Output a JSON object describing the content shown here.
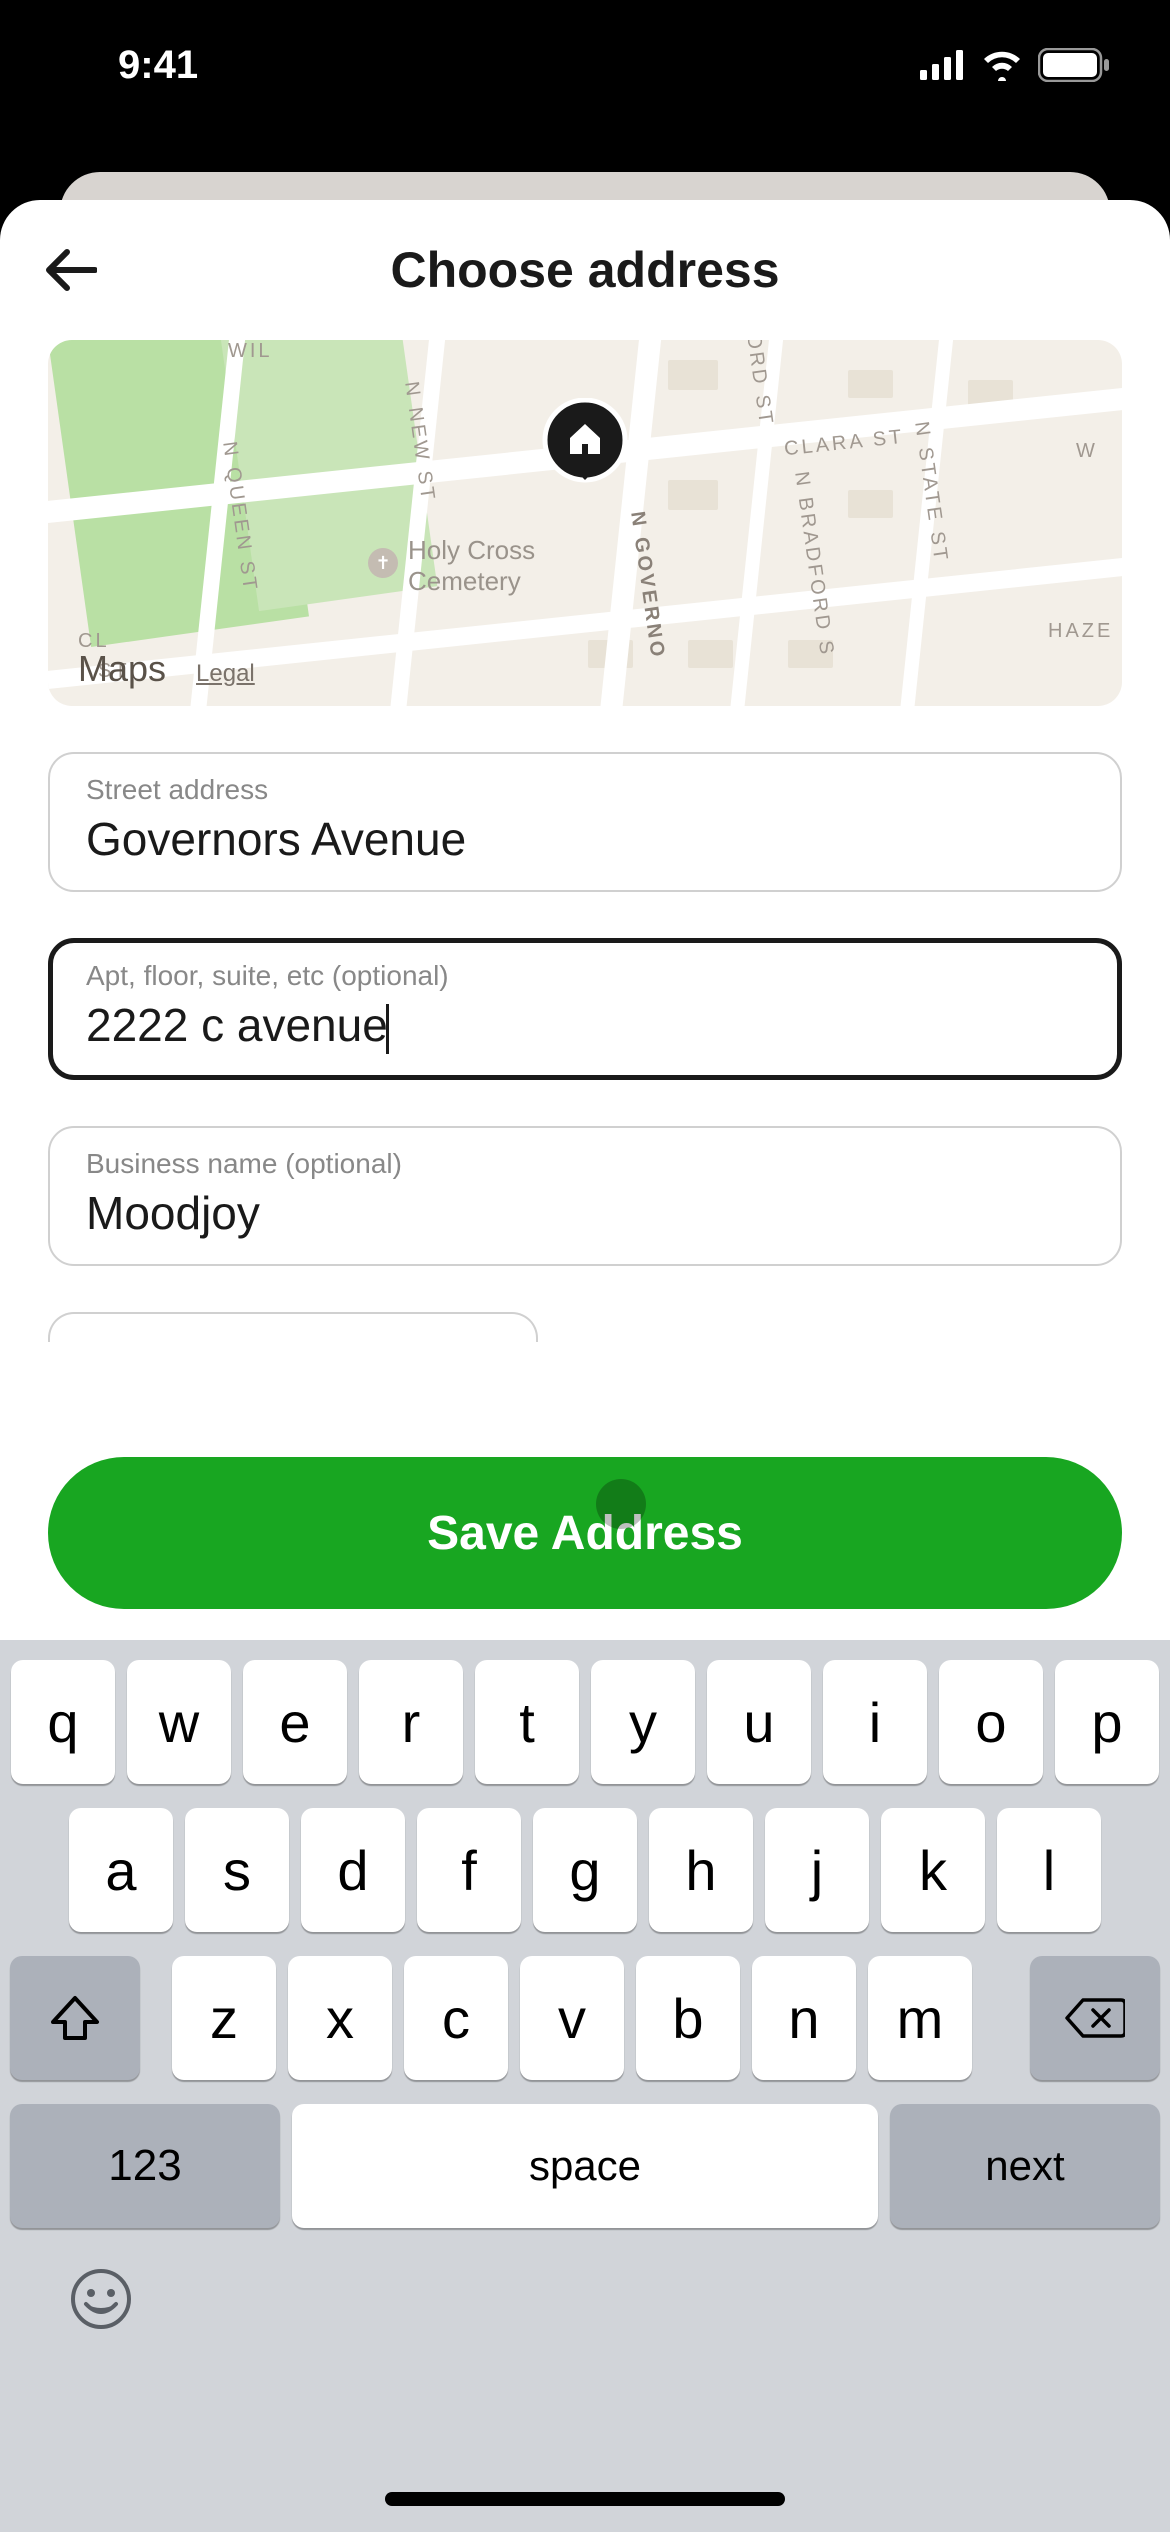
{
  "status": {
    "time": "9:41"
  },
  "header": {
    "title": "Choose address"
  },
  "map": {
    "attribution": "Maps",
    "legal": "Legal",
    "streets": {
      "queen": "N QUEEN ST",
      "new": "N NEW ST",
      "governor": "N GOVERNO",
      "bradford": "N BRADFORD S",
      "ord": "ORD ST",
      "clara": "CLARA ST",
      "state": "N STATE ST",
      "w": "W",
      "haze": "HAZE",
      "cl": "CL",
      "will": "WIL",
      "st": "ST"
    },
    "poi": {
      "cemetery": "Holy Cross\nCemetery"
    }
  },
  "fields": {
    "street": {
      "label": "Street address",
      "value": "Governors Avenue"
    },
    "apt": {
      "label": "Apt, floor, suite, etc (optional)",
      "value": "2222 c avenue"
    },
    "business": {
      "label": "Business name (optional)",
      "value": "Moodjoy"
    }
  },
  "save": {
    "label": "Save Address"
  },
  "keyboard": {
    "row1": [
      "q",
      "w",
      "e",
      "r",
      "t",
      "y",
      "u",
      "i",
      "o",
      "p"
    ],
    "row2": [
      "a",
      "s",
      "d",
      "f",
      "g",
      "h",
      "j",
      "k",
      "l"
    ],
    "row3": [
      "z",
      "x",
      "c",
      "v",
      "b",
      "n",
      "m"
    ],
    "numKey": "123",
    "space": "space",
    "next": "next"
  }
}
